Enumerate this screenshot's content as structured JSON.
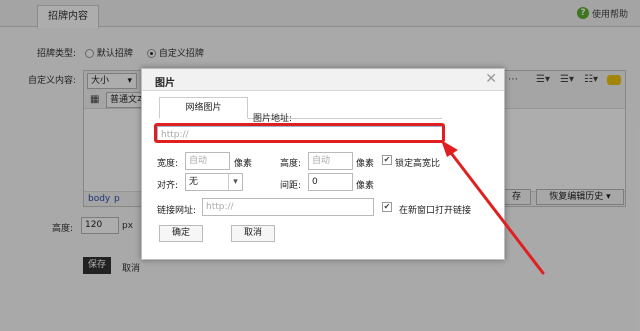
{
  "tab": {
    "label": "招牌内容"
  },
  "help": {
    "icon": "help-circle-icon",
    "label": "使用帮助"
  },
  "signboard_type": {
    "label": "招牌类型:",
    "options": [
      "默认招牌",
      "自定义招牌"
    ],
    "selected": "自定义招牌"
  },
  "custom_content": {
    "label": "自定义内容:"
  },
  "editor": {
    "size_select": "大小",
    "format_select": "普通文本",
    "status_path": [
      "body",
      "p"
    ],
    "save_label": "存",
    "history_label": "恢复编辑历史"
  },
  "height": {
    "label": "高度:",
    "value": "120",
    "unit": "px"
  },
  "page_actions": {
    "save": "保存",
    "cancel": "取消"
  },
  "dialog": {
    "title": "图片",
    "tab": "网络图片",
    "url_label": "图片地址:",
    "url_placeholder": "http://",
    "width_label": "宽度:",
    "width_placeholder": "自动",
    "px1": "像素",
    "height_label": "高度:",
    "height_placeholder": "自动",
    "px2": "像素",
    "lock_label": "锁定高宽比",
    "lock_checked": true,
    "align_label": "对齐:",
    "align_value": "无",
    "spacing_label": "间距:",
    "spacing_value": "0",
    "px3": "像素",
    "link_label": "链接网址:",
    "link_placeholder": "http://",
    "new_window_label": "在新窗口打开链接",
    "new_window_checked": true,
    "ok": "确定",
    "cancel": "取消"
  },
  "colors": {
    "highlight": "#e02020",
    "help_green": "#5fae2f"
  }
}
